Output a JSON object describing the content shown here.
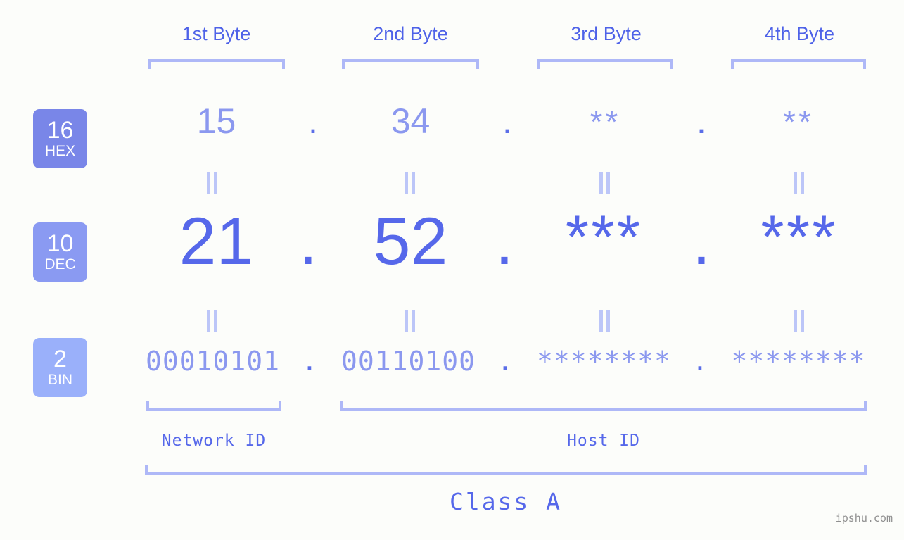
{
  "background_color": "#fcfdfa",
  "accent_color": "#5668ea",
  "accent_light": "#8b98ef",
  "bracket_color": "#aeb8f7",
  "byte_headers": [
    {
      "label": "1st Byte"
    },
    {
      "label": "2nd Byte"
    },
    {
      "label": "3rd Byte"
    },
    {
      "label": "4th Byte"
    }
  ],
  "bases": [
    {
      "number": "16",
      "name": "HEX",
      "color": "#7986e8"
    },
    {
      "number": "10",
      "name": "DEC",
      "color": "#8a9af2"
    },
    {
      "number": "2",
      "name": "BIN",
      "color": "#9ab0fa"
    }
  ],
  "rows": {
    "hex": {
      "values": [
        "15",
        "34",
        "**",
        "**"
      ],
      "separator": "."
    },
    "dec": {
      "values": [
        "21",
        "52",
        "***",
        "***"
      ],
      "separator": "."
    },
    "bin": {
      "values": [
        "00010101",
        "00110100",
        "********",
        "********"
      ],
      "separator": "."
    }
  },
  "equality_symbol": "=",
  "sections": {
    "network_id": "Network ID",
    "host_id": "Host ID",
    "class": "Class A"
  },
  "watermark": "ipshu.com"
}
